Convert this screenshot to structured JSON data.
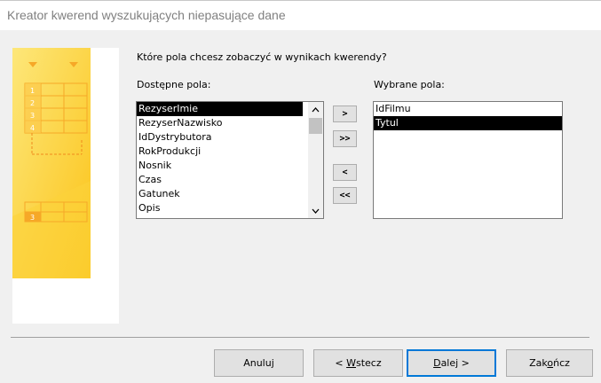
{
  "window": {
    "title": "Kreator kwerend wyszukujących niepasujące dane"
  },
  "question": "Które pola chcesz zobaczyć w wynikach kwerendy?",
  "available": {
    "label": "Dostępne pola:",
    "items": [
      "RezyserImie",
      "RezyserNazwisko",
      "IdDystrybutora",
      "RokProdukcji",
      "Nosnik",
      "Czas",
      "Gatunek",
      "Opis"
    ],
    "selected_index": 0
  },
  "selected_fields": {
    "label": "Wybrane pola:",
    "items": [
      "IdFilmu",
      "Tytul"
    ],
    "selected_index": 1
  },
  "move_buttons": {
    "add_one": ">",
    "add_all": ">>",
    "remove_one": "<",
    "remove_all": "<<"
  },
  "illustration": {
    "row_numbers": [
      "1",
      "2",
      "3",
      "4"
    ],
    "result_row_number": "3"
  },
  "footer": {
    "cancel": "Anuluj",
    "back_prefix": "< ",
    "back_accel": "W",
    "back_rest": "stecz",
    "next_accel": "D",
    "next_rest": "alej >",
    "finish_prefix": "Zak",
    "finish_accel": "o",
    "finish_rest": "ńcz"
  },
  "colors": {
    "illustration_bg": "#fde05a",
    "illustration_grid": "#f6a827",
    "selection": "#000000",
    "default_button_border": "#0078d7"
  },
  "icons": {
    "scroll_up": "chevron-up-icon",
    "scroll_down": "chevron-down-icon"
  }
}
